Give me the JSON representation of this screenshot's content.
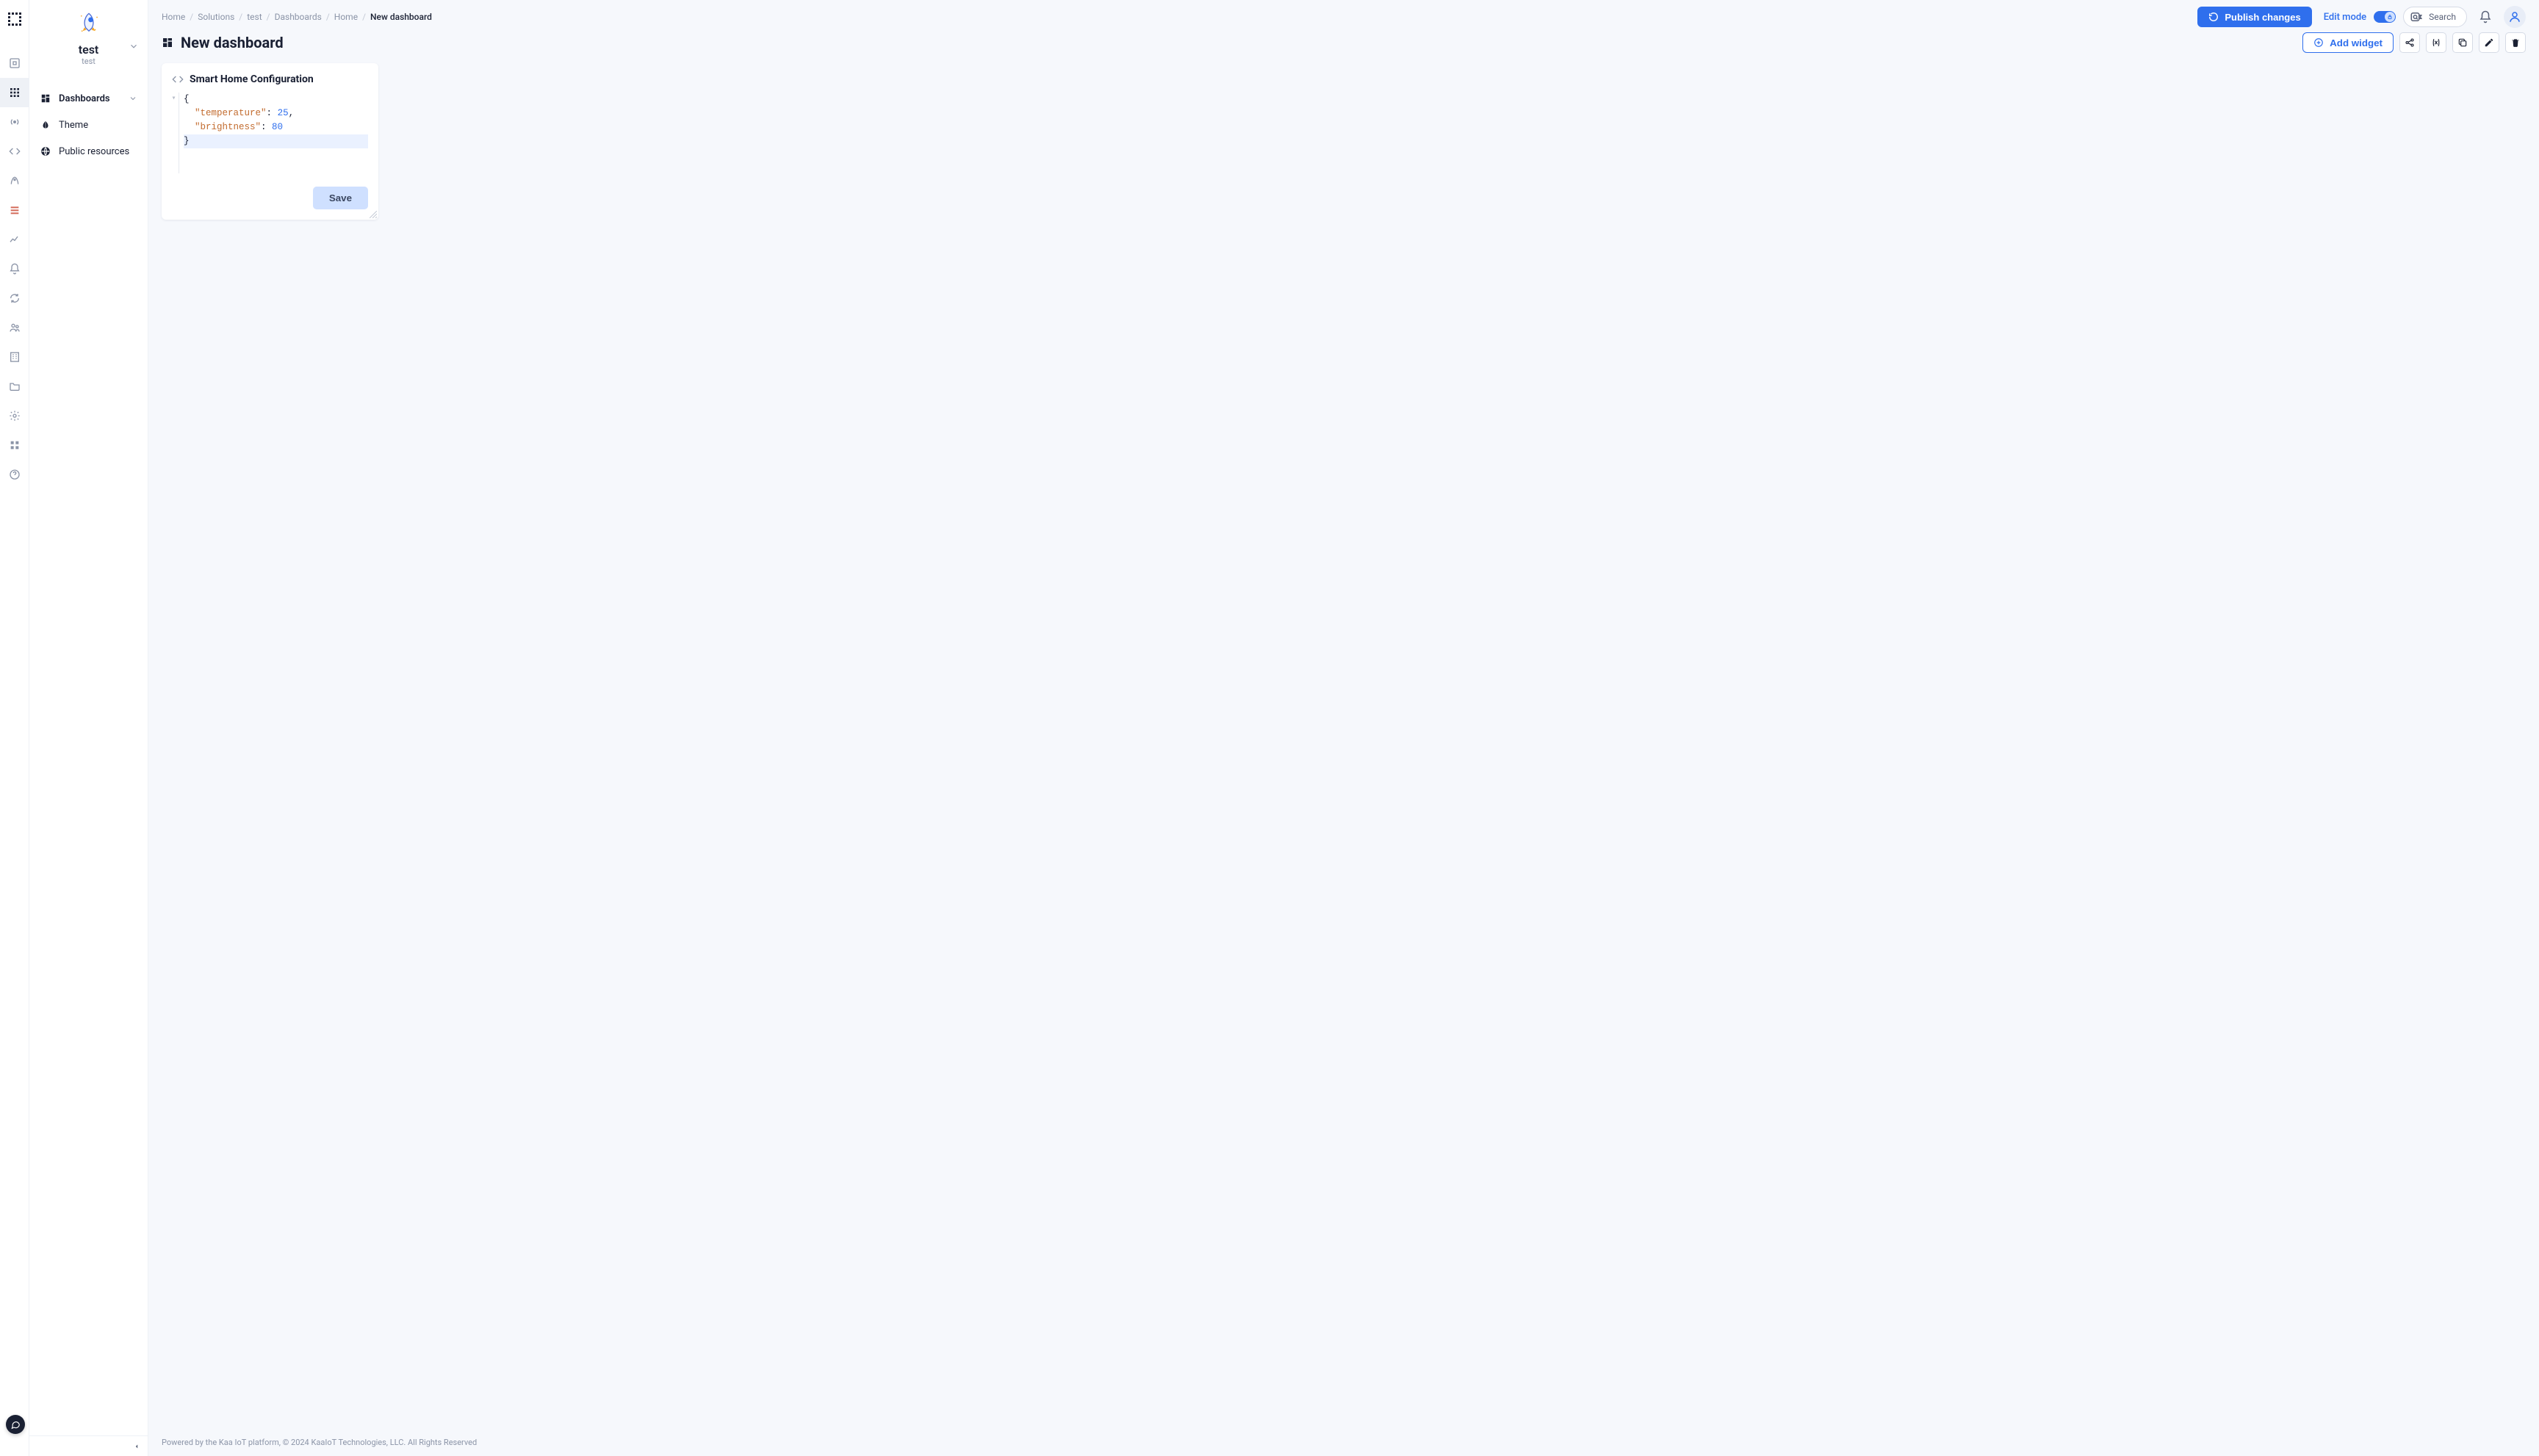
{
  "sidebar": {
    "tenant": "test",
    "sub": "test",
    "items": [
      {
        "id": "dashboards",
        "label": "Dashboards"
      },
      {
        "id": "theme",
        "label": "Theme"
      },
      {
        "id": "public-resources",
        "label": "Public resources"
      }
    ]
  },
  "breadcrumb": [
    "Home",
    "Solutions",
    "test",
    "Dashboards",
    "Home",
    "New dashboard"
  ],
  "topbar": {
    "publish_label": "Publish changes",
    "edit_mode_label": "Edit mode",
    "search_label": "Search"
  },
  "page": {
    "title": "New dashboard",
    "add_widget_label": "Add widget"
  },
  "widget": {
    "title": "Smart Home Configuration",
    "save_label": "Save",
    "code": {
      "line1_brace": "{",
      "line2_key": "\"temperature\"",
      "line2_sep": ": ",
      "line2_val": "25",
      "line2_tail": ",",
      "line3_key": "\"brightness\"",
      "line3_sep": ": ",
      "line3_val": "80",
      "line4_brace": "}"
    }
  },
  "footer": "Powered by the Kaa IoT platform, © 2024 KaaIoT Technologies, LLC. All Rights Reserved"
}
